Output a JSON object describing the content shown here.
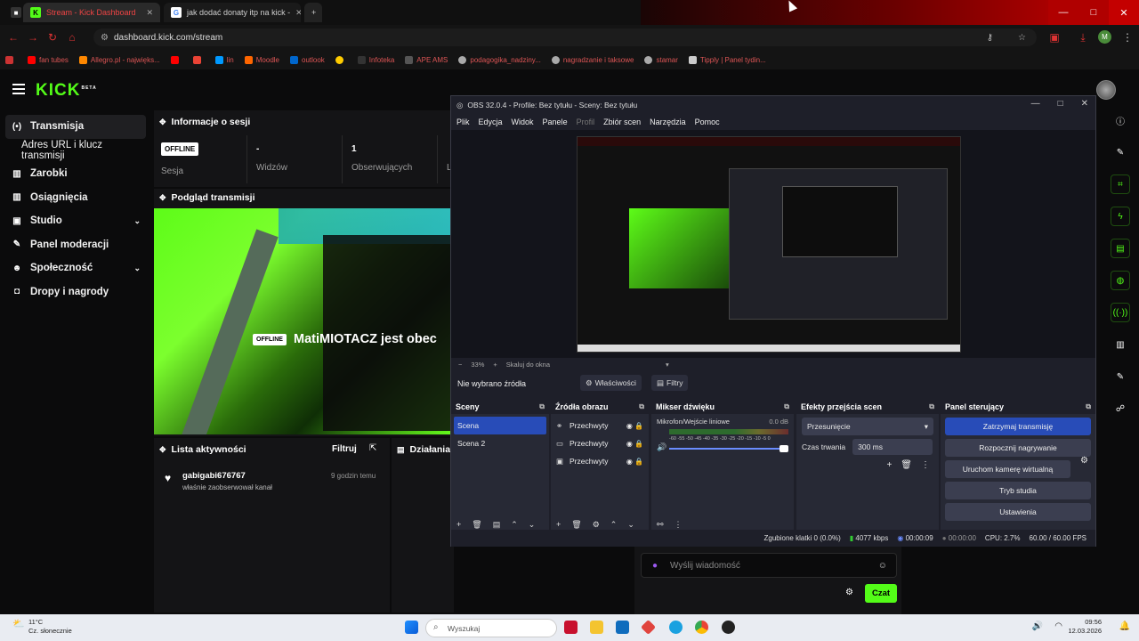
{
  "browser": {
    "tabs": [
      {
        "title": "Stream - Kick Dashboard"
      },
      {
        "title": "jak dodać donaty itp na kick -"
      }
    ],
    "url": "dashboard.kick.com/stream",
    "bookmarks": [
      "YouTube",
      "Allegro.pl",
      "",
      "",
      "",
      "Moodle",
      "outlook",
      "",
      "Librus",
      "APE AMS",
      "",
      "podaj",
      "",
      "",
      "",
      ""
    ],
    "bookmark_labels": {
      "b1": "fan tubes",
      "b2": "Allegro.pl - najwięks...",
      "b3": "YT",
      "b4": "Gmail",
      "b5": "MS",
      "b6": "lin",
      "b7": "Moodle",
      "b8": "outlook",
      "b9": "",
      "b10": "Infoteka",
      "b11": "APE AMS",
      "b12": "podagogika_nadziny...",
      "b13": "nagradzanie i taksowe",
      "b14": "stamar",
      "b15": "Tipply | Panel tydin..."
    }
  },
  "kick": {
    "logo": "KICK",
    "logo_sup": "BETA",
    "nav": [
      {
        "label": "Transmisja",
        "icon": "((•))"
      },
      {
        "label": "Adres URL i klucz transmisji",
        "icon": ""
      },
      {
        "label": "Zarobki",
        "icon": "▦"
      },
      {
        "label": "Osiągnięcia",
        "icon": "▦"
      },
      {
        "label": "Studio",
        "icon": "▣"
      },
      {
        "label": "Panel moderacji",
        "icon": "🔧"
      },
      {
        "label": "Społeczność",
        "icon": "👥"
      },
      {
        "label": "Dropy i nagrody",
        "icon": "🎁"
      }
    ],
    "session": {
      "title": "Informacje o sesji",
      "status_badge": "OFFLINE",
      "status_label": "Sesja",
      "viewers_value": "-",
      "viewers_label": "Widzów",
      "followers_value": "1",
      "followers_label": "Obserwujących",
      "extra_label": "L"
    },
    "preview": {
      "title": "Podgląd transmisji",
      "offline_badge": "OFFLINE",
      "offline_text": "MatiMIOTACZ jest obec"
    },
    "activity": {
      "title": "Lista aktywności",
      "filter": "Filtruj",
      "user": "gabigabi676767",
      "time": "9 godzin temu",
      "desc": "właśnie zaobserwował kanał"
    },
    "actions_title": "Działania m",
    "chat": {
      "placeholder": "Wyślij wiadomość",
      "send": "Czat"
    }
  },
  "obs": {
    "title": "OBS 32.0.4 - Profile: Bez tytułu - Sceny: Bez tytułu",
    "menu": [
      "Plik",
      "Edycja",
      "Widok",
      "Panele",
      "Profil",
      "Zbiór scen",
      "Narzędzia",
      "Pomoc"
    ],
    "zoom": "33%",
    "scale_label": "Skaluj do okna",
    "no_source": "Nie wybrano źródła",
    "props_btn": "Właściwości",
    "filters_btn": "Filtry",
    "scenes_title": "Sceny",
    "scenes": [
      "Scena",
      "Scena 2"
    ],
    "sources_title": "Źródła obrazu",
    "sources": [
      "Przechwyty",
      "Przechwyty",
      "Przechwyty"
    ],
    "mixer_title": "Mikser dźwięku",
    "mixer_channel": "Mikrofon/Wejście liniowe",
    "mixer_db": "0.0 dB",
    "mixer_scale": "-60 -55 -50 -45 -40 -35 -30 -25 -20 -15 -10 -5 0",
    "transitions_title": "Efekty przejścia scen",
    "transition": "Przesunięcie",
    "duration_label": "Czas trwania",
    "duration_value": "300 ms",
    "controls_title": "Panel sterujący",
    "controls": [
      "Zatrzymaj transmisję",
      "Rozpocznij nagrywanie",
      "Uruchom kamerę wirtualną",
      "Tryb studia",
      "Ustawienia"
    ],
    "status": {
      "dropped": "Zgubione klatki 0 (0.0%)",
      "bitrate": "4077 kbps",
      "stream_time": "00:00:09",
      "rec_time": "00:00:00",
      "cpu": "CPU: 2.7%",
      "fps": "60.00 / 60.00 FPS"
    },
    "accent": "#284cb8"
  },
  "taskbar": {
    "weather_temp": "11°C",
    "weather_desc": "Cz. słonecznie",
    "search": "Wyszukaj",
    "time": "09:56",
    "date": "12.03.2026"
  },
  "colors": {
    "kick_green": "#53fc18",
    "obs_bg": "#1e1f29"
  }
}
